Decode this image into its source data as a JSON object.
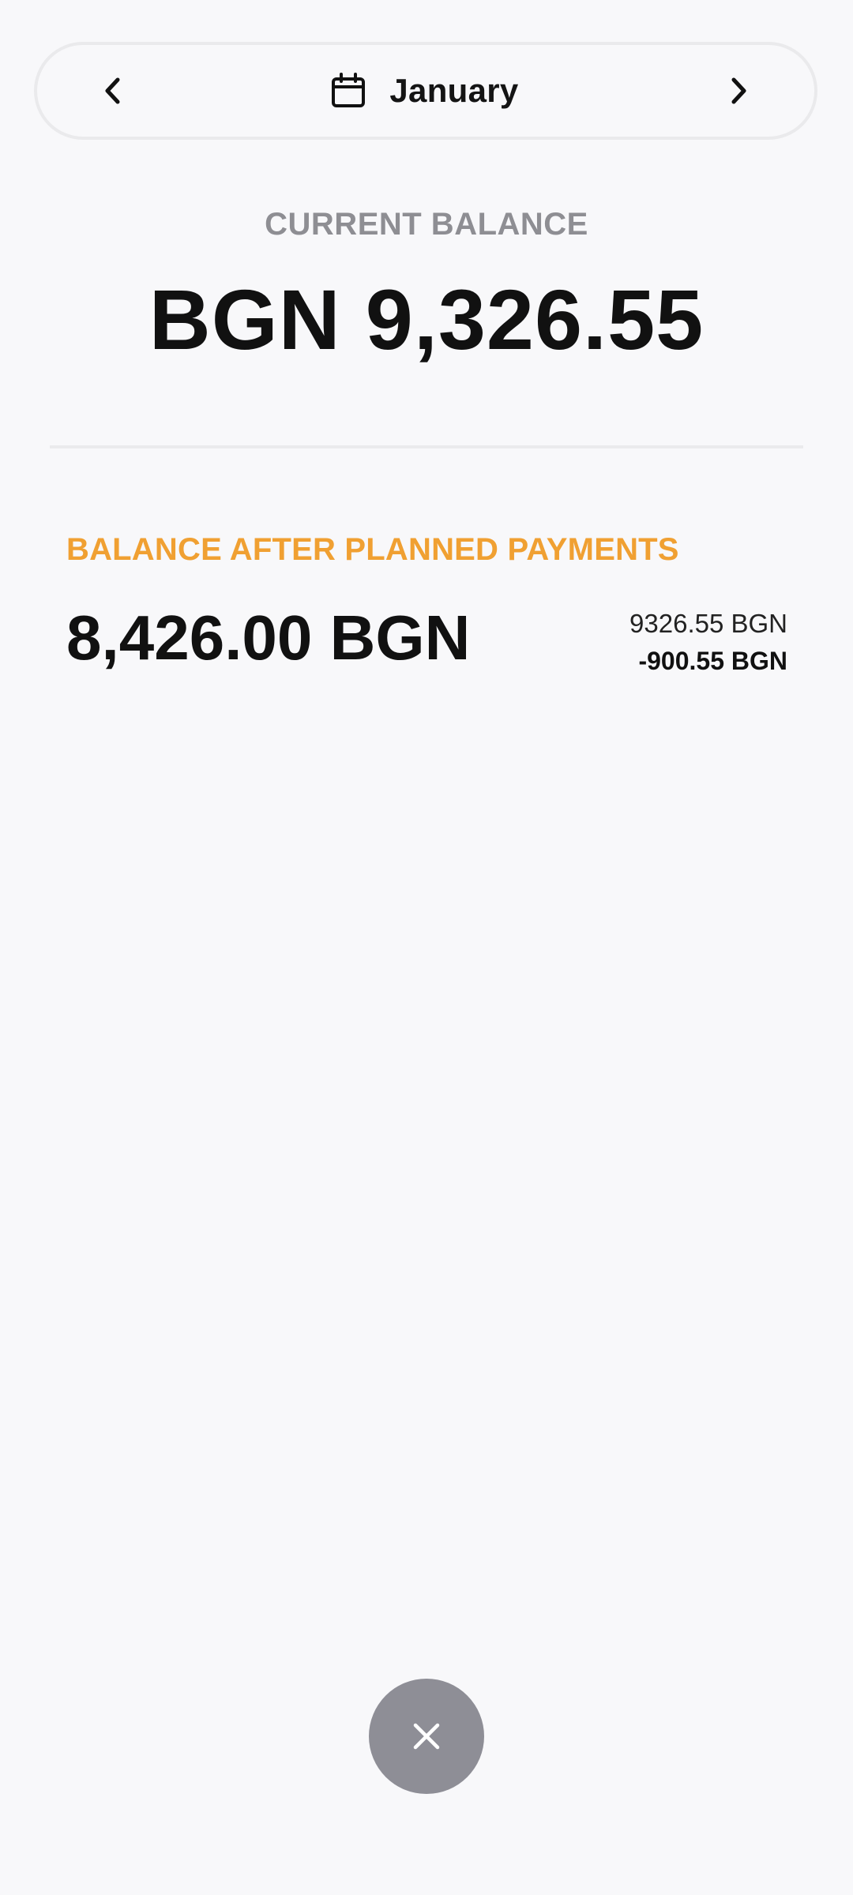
{
  "month_picker": {
    "month": "January",
    "prev_icon": "chevron-left-icon",
    "next_icon": "chevron-right-icon",
    "calendar_icon": "calendar-icon"
  },
  "current_balance": {
    "title": "CURRENT BALANCE",
    "amount": "BGN 9,326.55"
  },
  "planned": {
    "title": "BALANCE AFTER PLANNED PAYMENTS",
    "amount": "8,426.00 BGN",
    "current": "9326.55 BGN",
    "planned_total": "-900.55 BGN"
  },
  "fab": {
    "icon": "close-icon"
  },
  "colors": {
    "background": "#f8f8fa",
    "accent": "#f0a032",
    "muted": "#8e8e93",
    "fab": "#8e8e96"
  }
}
